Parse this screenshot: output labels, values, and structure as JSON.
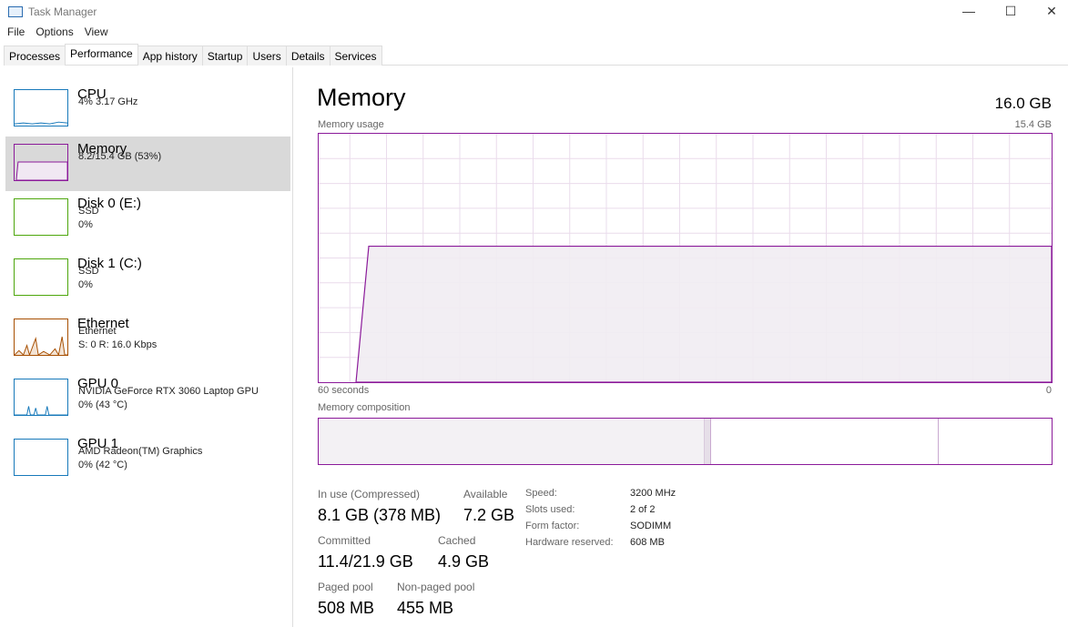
{
  "window": {
    "title": "Task Manager"
  },
  "menu": [
    "File",
    "Options",
    "View"
  ],
  "tabs": [
    "Processes",
    "Performance",
    "App history",
    "Startup",
    "Users",
    "Details",
    "Services"
  ],
  "sidebar": [
    {
      "name": "CPU",
      "lines": [
        "4%  3.17 GHz"
      ],
      "color": "#1779ba"
    },
    {
      "name": "Memory",
      "lines": [
        "8.2/15.4 GB (53%)"
      ],
      "color": "#8b1a9a"
    },
    {
      "name": "Disk 0 (E:)",
      "lines": [
        "SSD",
        "0%"
      ],
      "color": "#4da60c"
    },
    {
      "name": "Disk 1 (C:)",
      "lines": [
        "SSD",
        "0%"
      ],
      "color": "#4da60c"
    },
    {
      "name": "Ethernet",
      "lines": [
        "Ethernet",
        "S: 0  R: 16.0 Kbps"
      ],
      "color": "#a74f01"
    },
    {
      "name": "GPU 0",
      "lines": [
        "NVIDIA GeForce RTX 3060 Laptop GPU",
        "0%  (43 °C)"
      ],
      "color": "#1779ba"
    },
    {
      "name": "GPU 1",
      "lines": [
        "AMD Radeon(TM) Graphics",
        "0%  (42 °C)"
      ],
      "color": "#1779ba"
    }
  ],
  "main": {
    "title": "Memory",
    "total": "16.0 GB",
    "usage_label": "Memory usage",
    "usage_max": "15.4 GB",
    "x_left": "60 seconds",
    "x_right": "0",
    "usage_percent": 54,
    "composition_label": "Memory composition",
    "stats": {
      "in_use_label": "In use (Compressed)",
      "in_use": "8.1 GB (378 MB)",
      "available_label": "Available",
      "available": "7.2 GB",
      "committed_label": "Committed",
      "committed": "11.4/21.9 GB",
      "cached_label": "Cached",
      "cached": "4.9 GB",
      "paged_label": "Paged pool",
      "paged": "508 MB",
      "nonpaged_label": "Non-paged pool",
      "nonpaged": "455 MB"
    },
    "details": [
      {
        "k": "Speed:",
        "v": "3200 MHz"
      },
      {
        "k": "Slots used:",
        "v": "2 of 2"
      },
      {
        "k": "Form factor:",
        "v": "SODIMM"
      },
      {
        "k": "Hardware reserved:",
        "v": "608 MB"
      }
    ]
  }
}
